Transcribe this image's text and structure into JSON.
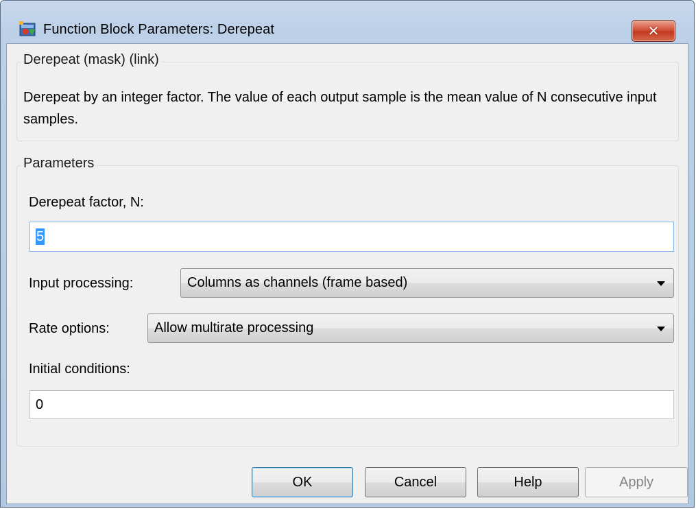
{
  "window": {
    "title": "Function Block Parameters: Derepeat",
    "close_label": "✕",
    "icon": "simulink-block-icon"
  },
  "description_group": {
    "legend": "Derepeat (mask) (link)",
    "text": "Derepeat by an integer factor.  The value of each output sample is the mean value of N consecutive input samples."
  },
  "parameters_group": {
    "legend": "Parameters",
    "derepeat_factor": {
      "label": "Derepeat factor, N:",
      "value": "5"
    },
    "input_processing": {
      "label": "Input processing:",
      "value": "Columns as channels (frame based)"
    },
    "rate_options": {
      "label": "Rate options:",
      "value": "Allow multirate processing"
    },
    "initial_conditions": {
      "label": "Initial conditions:",
      "value": "0"
    }
  },
  "buttons": {
    "ok": "OK",
    "cancel": "Cancel",
    "help": "Help",
    "apply": "Apply"
  },
  "colors": {
    "close_button": "#c7432a",
    "selection": "#3399ff",
    "client_bg": "#f0f0f0"
  }
}
